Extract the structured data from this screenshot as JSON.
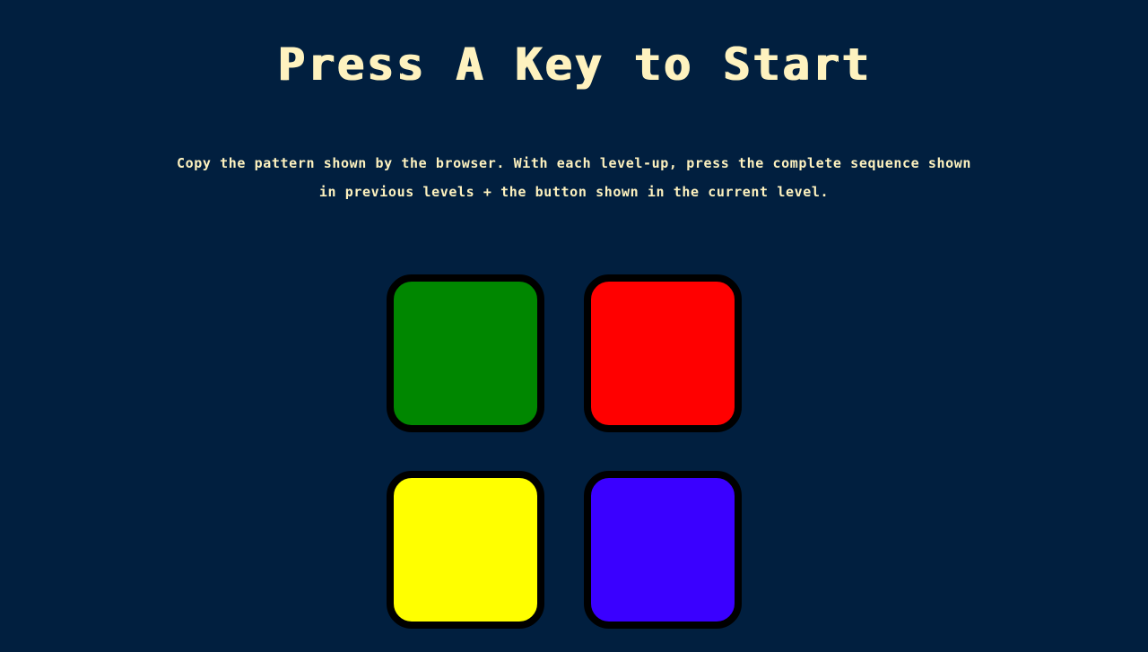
{
  "header": {
    "title": "Press A Key to Start"
  },
  "instructions": "Copy the pattern shown by the browser. With each level-up, press the complete sequence shown in previous levels + the button shown in the current level.",
  "buttons": [
    {
      "id": "green",
      "color": "#008700"
    },
    {
      "id": "red",
      "color": "#FF0000"
    },
    {
      "id": "yellow",
      "color": "#FFFF00"
    },
    {
      "id": "blue",
      "color": "#3A00FF"
    }
  ],
  "colors": {
    "background": "#011F3F",
    "text": "#FEF2BF",
    "button_border": "#000000"
  }
}
